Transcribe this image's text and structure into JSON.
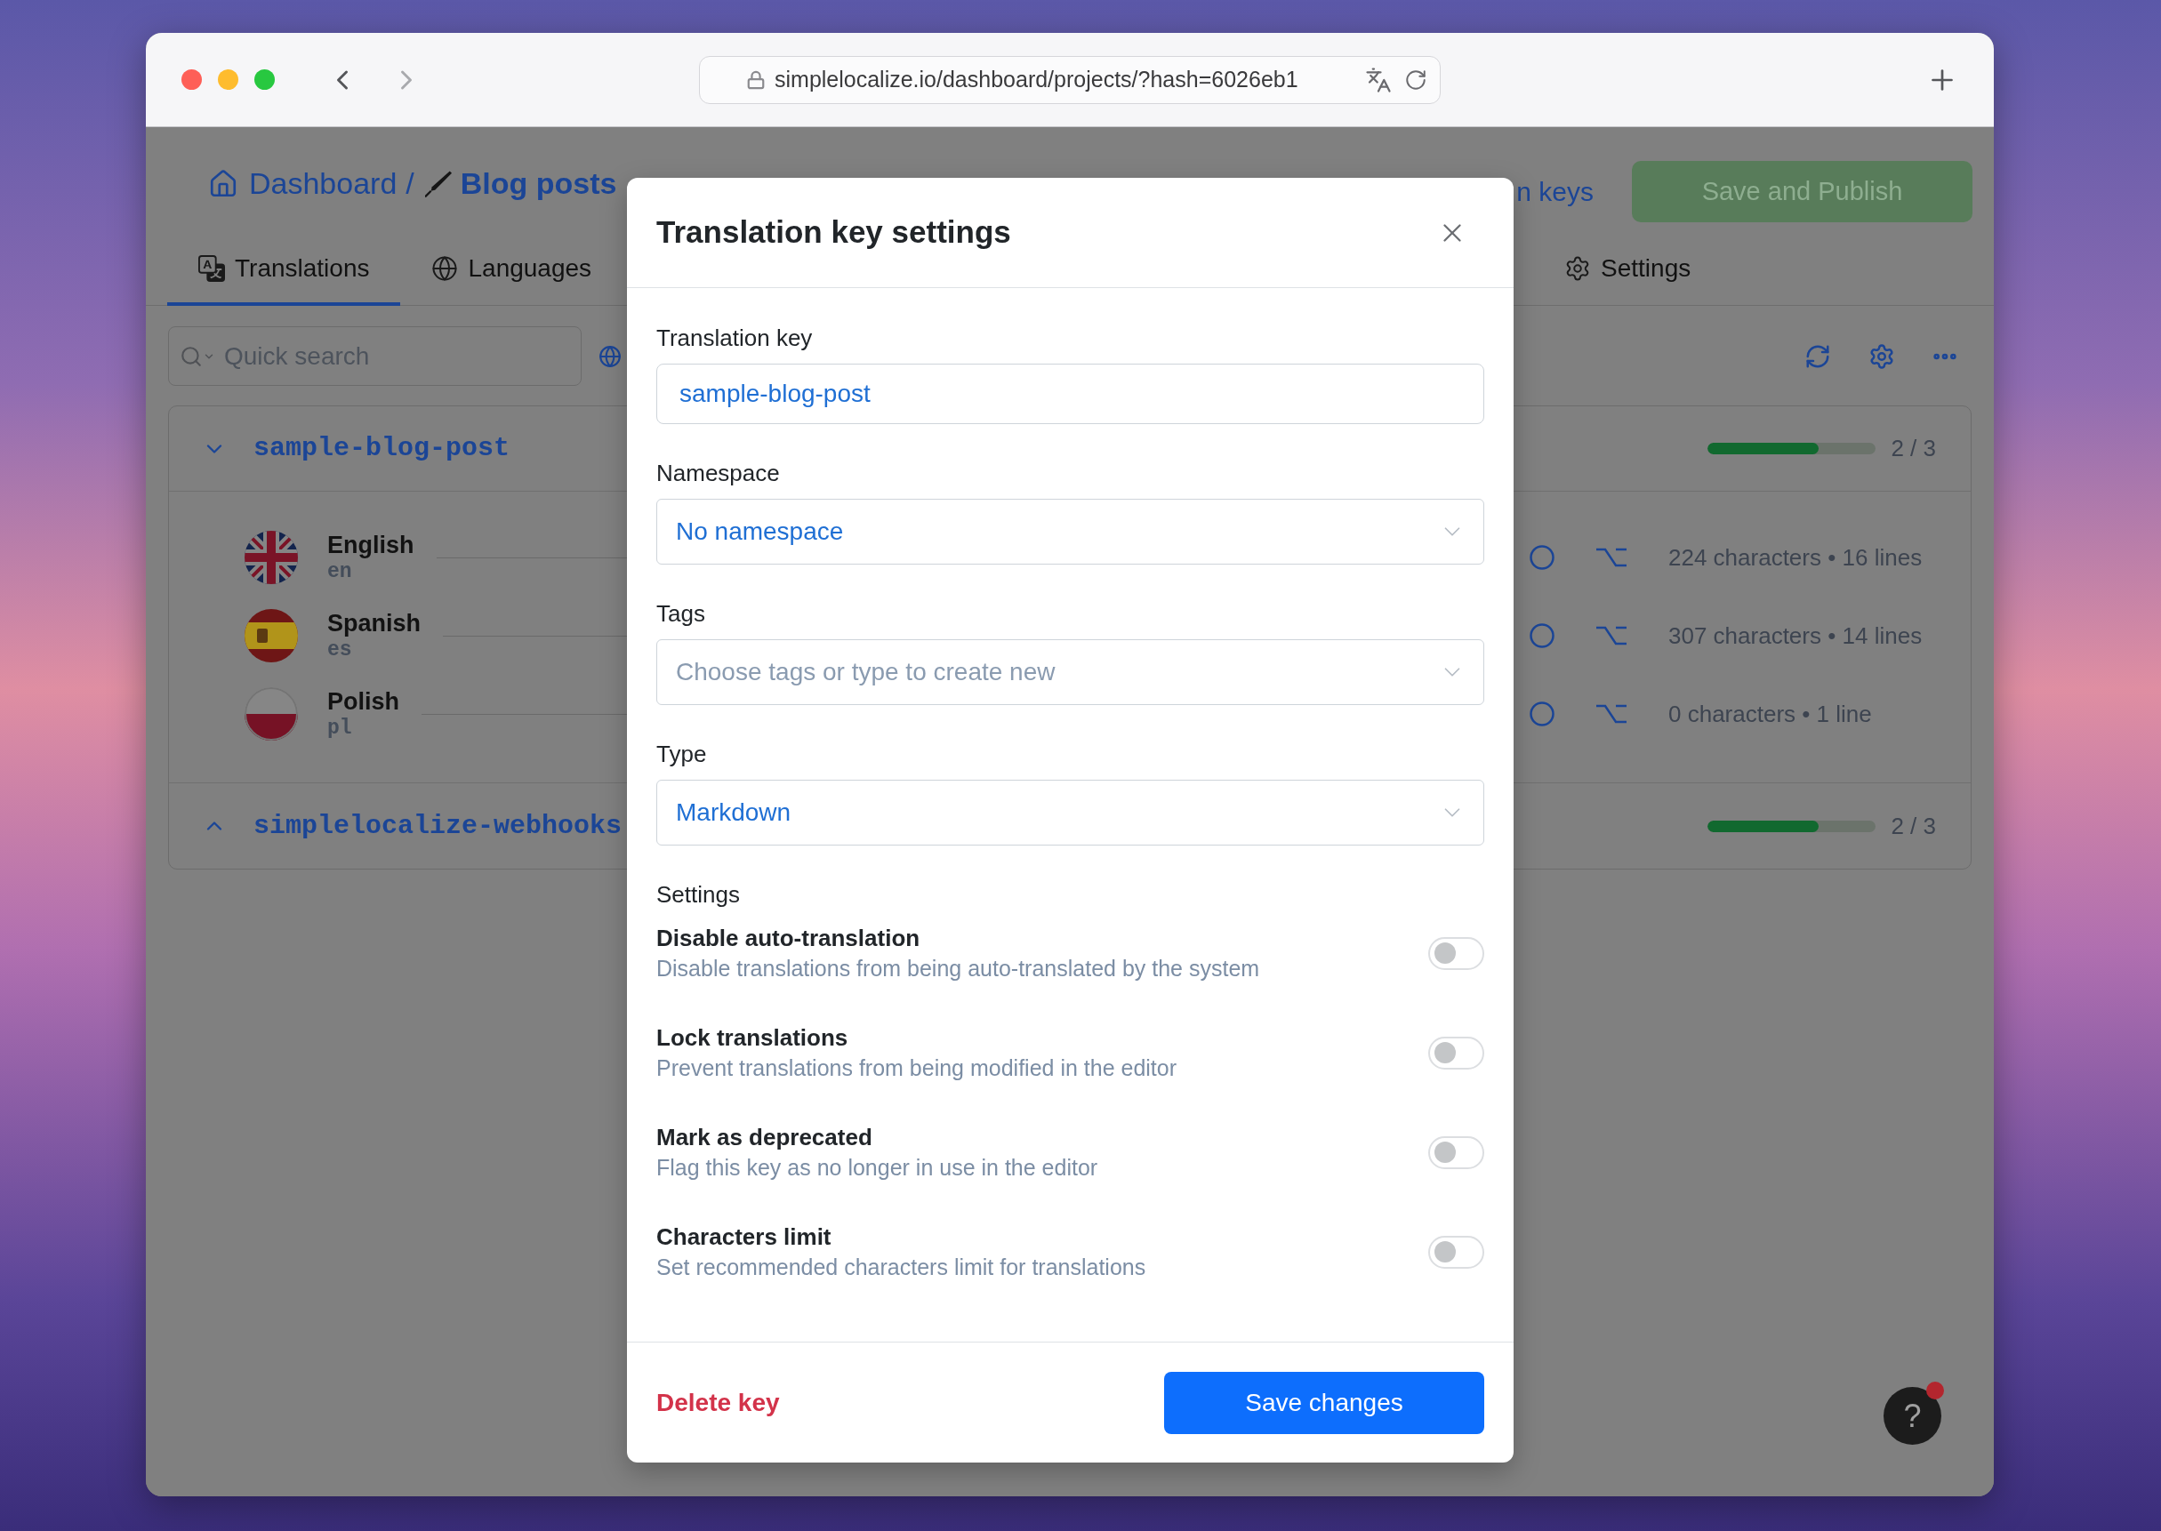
{
  "browser": {
    "url": "simplelocalize.io/dashboard/projects/?hash=6026eb1"
  },
  "header": {
    "breadcrumb": {
      "home": "Dashboard",
      "separator": "/",
      "project": "Blog posts"
    },
    "link": "n keys",
    "publish_button": {
      "label": "Save and Publish",
      "disabled": true
    }
  },
  "tabs": [
    {
      "label": "Translations",
      "selected": true
    },
    {
      "label": "Languages",
      "selected": false
    },
    {
      "label": "Settings",
      "selected": false
    }
  ],
  "search": {
    "placeholder": "Quick search"
  },
  "keys": [
    {
      "name": "sample-blog-post",
      "expanded": true,
      "level": 0.66,
      "progress": "2 / 3",
      "translations": [
        {
          "language": "English",
          "code": "en",
          "stats": "224 characters • 16 lines"
        },
        {
          "language": "Spanish",
          "code": "es",
          "stats": "307 characters • 14 lines"
        },
        {
          "language": "Polish",
          "code": "pl",
          "stats": "0 characters • 1 line"
        }
      ]
    },
    {
      "name": "simplelocalize-webhooks",
      "expanded": false,
      "level": 0.66,
      "progress": "2 / 3"
    }
  ],
  "modal": {
    "title": "Translation key settings",
    "fields": [
      {
        "kind": "input",
        "label": "Translation key",
        "value": "sample-blog-post"
      },
      {
        "kind": "select",
        "label": "Namespace",
        "value": "No namespace"
      },
      {
        "kind": "select",
        "label": "Tags",
        "placeholder": "Choose tags or type to create new"
      },
      {
        "kind": "select",
        "label": "Type",
        "value": "Markdown"
      }
    ],
    "settings_heading": "Settings",
    "settings": [
      {
        "title": "Disable auto-translation",
        "description": "Disable translations from being auto-translated by the system",
        "on": false
      },
      {
        "title": "Lock translations",
        "description": "Prevent translations from being modified in the editor",
        "on": false
      },
      {
        "title": "Mark as deprecated",
        "description": "Flag this key as no longer in use in the editor",
        "on": false
      },
      {
        "title": "Characters limit",
        "description": "Set recommended characters limit for translations",
        "on": false
      }
    ],
    "delete_button": "Delete key",
    "save_button": "Save changes"
  },
  "help_button": {
    "label": "?",
    "notification": true
  }
}
